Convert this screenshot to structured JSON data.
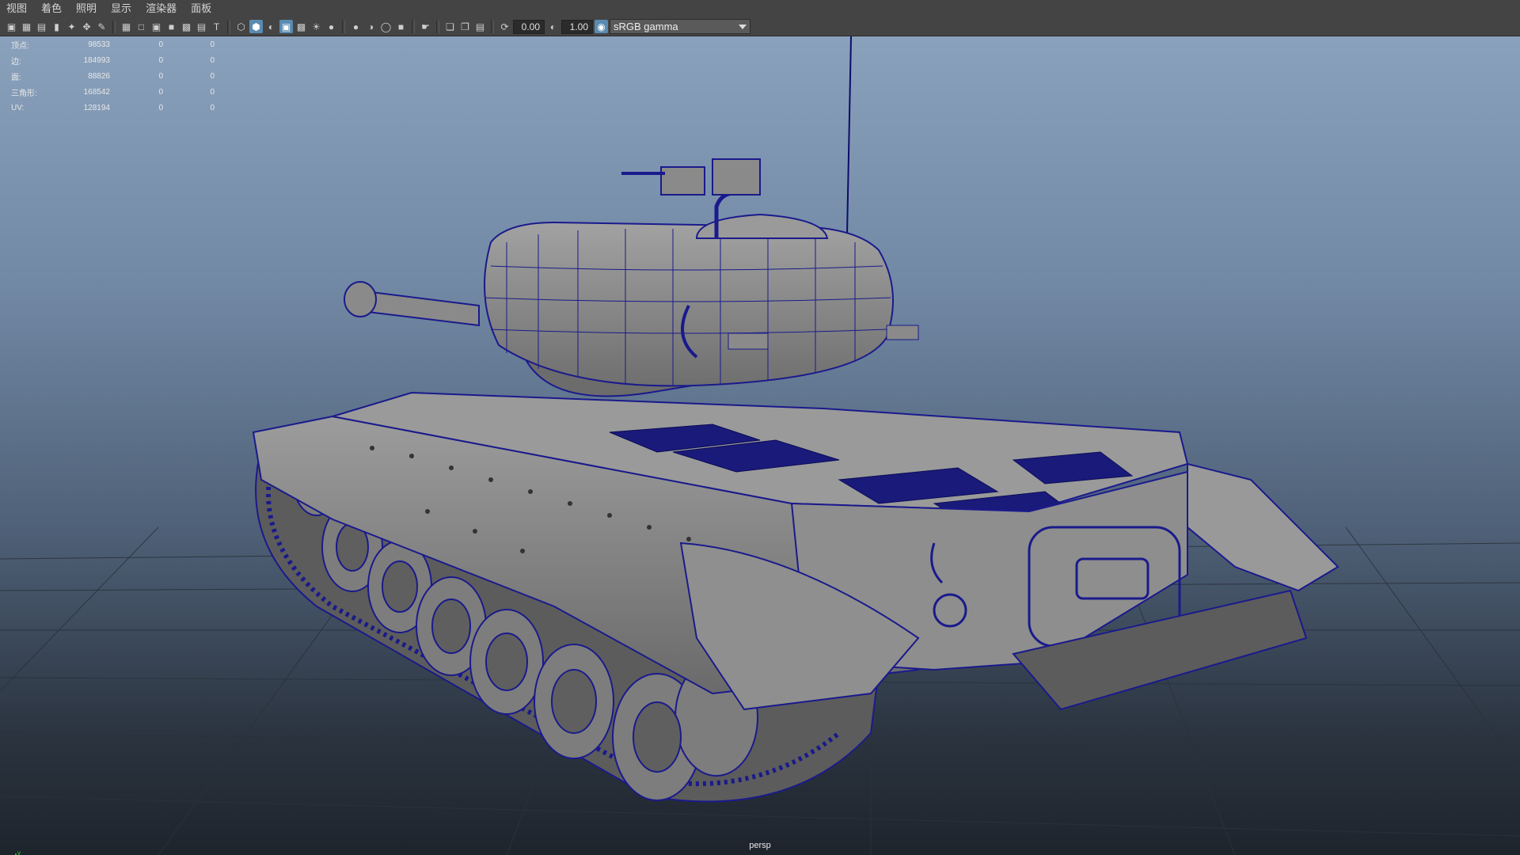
{
  "menubar": {
    "items": [
      "视图",
      "着色",
      "照明",
      "显示",
      "渲染器",
      "面板"
    ]
  },
  "toolbar": {
    "exposure_value": "0.00",
    "gamma_value": "1.00",
    "color_space": "sRGB gamma",
    "icons": [
      "camera-icon",
      "camera-attr-icon",
      "camera-bookmark-icon",
      "bookmark-icon",
      "image-plane-icon",
      "camera-move-icon",
      "pencil-icon",
      "grid-icon",
      "film-gate-icon",
      "resolution-gate-icon",
      "gate-mask-icon",
      "field-chart-icon",
      "safe-action-icon",
      "safe-title-icon",
      "wireframe-icon",
      "smooth-shade-icon",
      "shade-default-icon",
      "wireframe-on-shaded-icon",
      "xray-icon",
      "lights-icon",
      "shadows-icon",
      "ambient-occlusion-icon",
      "motion-blur-icon",
      "antialias-icon",
      "depth-of-field-icon",
      "isolate-icon",
      "select-icon",
      "xray-joints-icon",
      "xray-active-icon",
      "backface-icon",
      "exposure-icon",
      "gamma-icon",
      "color-management-icon"
    ]
  },
  "hud": {
    "rows": [
      {
        "label": "顶点:",
        "v1": "98533",
        "v2": "0",
        "v3": "0"
      },
      {
        "label": "边:",
        "v1": "184993",
        "v2": "0",
        "v3": "0"
      },
      {
        "label": "面:",
        "v1": "88826",
        "v2": "0",
        "v3": "0"
      },
      {
        "label": "三角形:",
        "v1": "168542",
        "v2": "0",
        "v3": "0"
      },
      {
        "label": "UV:",
        "v1": "128194",
        "v2": "0",
        "v3": "0"
      }
    ]
  },
  "viewport": {
    "camera_label": "persp",
    "axis_y": "y"
  },
  "colors": {
    "wire": "#1a1a8c",
    "hull": "#8a8a8a",
    "grid": "#2a323c"
  }
}
